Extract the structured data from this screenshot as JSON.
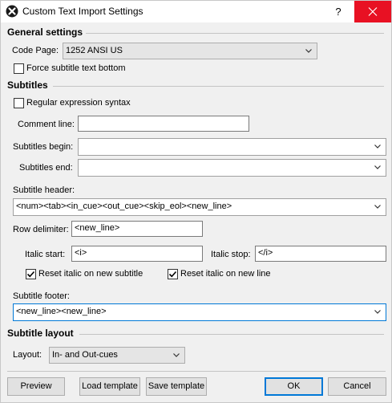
{
  "window": {
    "title": "Custom Text Import Settings",
    "help_label": "?"
  },
  "general": {
    "title": "General settings",
    "code_page_label": "Code Page:",
    "code_page_value": "1252 ANSI US",
    "force_bottom_label": "Force subtitle text bottom",
    "force_bottom_checked": false
  },
  "subtitles": {
    "title": "Subtitles",
    "regex_label": "Regular expression syntax",
    "regex_checked": false,
    "comment_label": "Comment line:",
    "comment_value": "",
    "begin_label": "Subtitles begin:",
    "begin_value": "",
    "end_label": "Subtitles end:",
    "end_value": "",
    "header_label": "Subtitle header:",
    "header_value": "<num><tab><in_cue><out_cue><skip_eol><new_line>",
    "row_delim_label": "Row delimiter:",
    "row_delim_value": "<new_line>",
    "italic_start_label": "Italic start:",
    "italic_start_value": "<i>",
    "italic_stop_label": "Italic stop:",
    "italic_stop_value": "</i>",
    "reset_italic_subtitle_label": "Reset italic on new subtitle",
    "reset_italic_subtitle_checked": true,
    "reset_italic_line_label": "Reset italic on new line",
    "reset_italic_line_checked": true,
    "footer_label": "Subtitle footer:",
    "footer_value": "<new_line><new_line>"
  },
  "layout": {
    "title": "Subtitle layout",
    "layout_label": "Layout:",
    "layout_value": "In- and Out-cues"
  },
  "buttons": {
    "preview": "Preview",
    "load_template": "Load template",
    "save_template": "Save template",
    "ok": "OK",
    "cancel": "Cancel"
  },
  "colors": {
    "close_bg": "#e81123",
    "focus_border": "#0078d7",
    "ok_border": "#0078d7"
  }
}
